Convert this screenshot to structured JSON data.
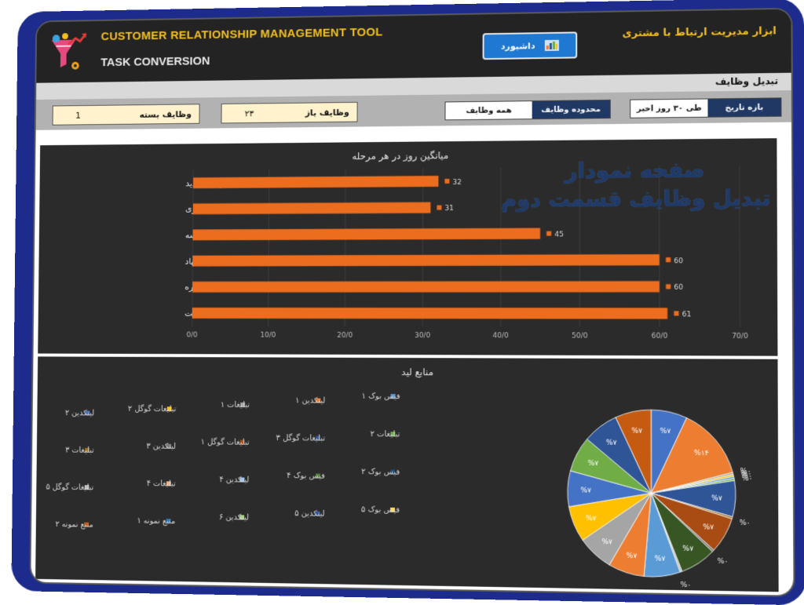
{
  "header": {
    "app_title": "CUSTOMER RELATIONSHIP MANAGEMENT TOOL",
    "page_title": "TASK CONVERSION",
    "app_title_fa": "ابزار مدیریت ارتباط با مشتری",
    "dashboard_button": "داشبورد",
    "section_title": "تبدیل وظایف"
  },
  "filters": {
    "closed_tasks_label": "وظایف بسته",
    "closed_tasks_value": "1",
    "open_tasks_label": "وظایف باز",
    "open_tasks_value": "۲۳",
    "task_scope_label": "محدوده وظایف",
    "task_scope_value": "همه وظایف",
    "date_range_label": "بازه تاریخ",
    "date_range_value": "طی ۳۰ روز اخیر"
  },
  "overlay": {
    "line1": "صفحه نمودار",
    "line2": "تبدیل وظایف قسمت دوم"
  },
  "colors": {
    "bar": "#ed6d1e",
    "chart_bg": "#2b2b2b",
    "accent_yellow": "#f2c01e",
    "button_blue": "#1f78d1"
  },
  "chart_data": [
    {
      "type": "bar",
      "orientation": "horizontal",
      "title": "میانگین روز در هر مرحله",
      "categories": [
        "فرصت جدید",
        "صلاحیت رهبری",
        "تماس / جلسه",
        "پیشنهاد",
        "مذاکره",
        "برنده / باخت"
      ],
      "values": [
        32,
        31,
        45,
        60,
        60,
        61
      ],
      "ticks": [
        "0/0",
        "10/0",
        "20/0",
        "30/0",
        "40/0",
        "50/0",
        "60/0",
        "70/0"
      ],
      "xlim": [
        0,
        70
      ]
    },
    {
      "type": "pie",
      "title": "منابع لید",
      "legend": [
        {
          "name": "لینکدین ۲",
          "color": "#4472c4"
        },
        {
          "name": "تبلیغات گوگل ۲",
          "color": "#ffc000"
        },
        {
          "name": "تبلیغات ۱",
          "color": "#a5a5a5"
        },
        {
          "name": "لینکدین ۱",
          "color": "#ed7d31"
        },
        {
          "name": "فیس بوک ۱",
          "color": "#5b9bd5"
        },
        {
          "name": "تبلیغات ۳",
          "color": "#9e6b16"
        },
        {
          "name": "لینکدین ۳",
          "color": "#7a7a7a"
        },
        {
          "name": "تبلیغات گوگل ۱",
          "color": "#a94c13"
        },
        {
          "name": "تبلیغات گوگل ۳",
          "color": "#2f5597"
        },
        {
          "name": "تبلیغات ۲",
          "color": "#70ad47"
        },
        {
          "name": "تبلیغات گوگل ۵",
          "color": "#bcbcbc"
        },
        {
          "name": "تبلیغات ۴",
          "color": "#f4b183"
        },
        {
          "name": "لینکدین ۴",
          "color": "#9dc3e6"
        },
        {
          "name": "فیس بوک ۴",
          "color": "#548235"
        },
        {
          "name": "فیس بوک ۲",
          "color": "#1f4e79"
        },
        {
          "name": "منبع نمونه ۲",
          "color": "#c55a11"
        },
        {
          "name": "منبع نمونه ۱",
          "color": "#2e75b6"
        },
        {
          "name": "لینکدین ۶",
          "color": "#a9d18e"
        },
        {
          "name": "لینکدین ۵",
          "color": "#335aa0"
        },
        {
          "name": "فیس بوک ۵",
          "color": "#ffd966"
        }
      ],
      "slices": [
        {
          "value": 7,
          "label": "%۷",
          "color": "#4472c4"
        },
        {
          "value": 14,
          "label": "%۱۴",
          "color": "#ed7d31"
        },
        {
          "value": 0,
          "label": "%۰",
          "color": "#a5a5a5"
        },
        {
          "value": 0,
          "label": "%۰",
          "color": "#ffc000"
        },
        {
          "value": 0,
          "label": "%۰",
          "color": "#5b9bd5"
        },
        {
          "value": 0,
          "label": "%۰",
          "color": "#70ad47"
        },
        {
          "value": 7,
          "label": "%۷",
          "color": "#2f5597"
        },
        {
          "value": 0,
          "label": "%۰",
          "color": "#9e6b16"
        },
        {
          "value": 7,
          "label": "%۷",
          "color": "#a94c13"
        },
        {
          "value": 0,
          "label": "%۰",
          "color": "#7a7a7a"
        },
        {
          "value": 7,
          "label": "%۷",
          "color": "#375623"
        },
        {
          "value": 0,
          "label": "%۰",
          "color": "#bcbcbc"
        },
        {
          "value": 7,
          "label": "%۷",
          "color": "#5b9bd5"
        },
        {
          "value": 7,
          "label": "%۷",
          "color": "#ed7d31"
        },
        {
          "value": 7,
          "label": "%۷",
          "color": "#a5a5a5"
        },
        {
          "value": 7,
          "label": "%۷",
          "color": "#ffc000"
        },
        {
          "value": 7,
          "label": "%۷",
          "color": "#4472c4"
        },
        {
          "value": 7,
          "label": "%۷",
          "color": "#70ad47"
        },
        {
          "value": 7,
          "label": "%۷",
          "color": "#2f5597"
        },
        {
          "value": 7,
          "label": "%۷",
          "color": "#c55a11"
        }
      ]
    }
  ]
}
